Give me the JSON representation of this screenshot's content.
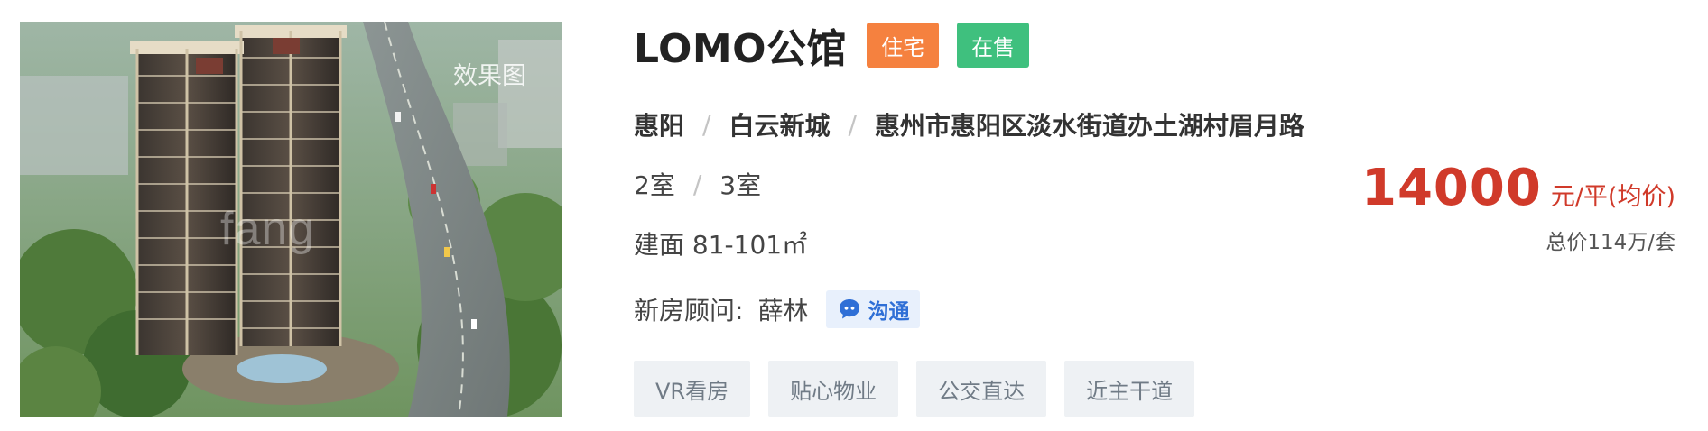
{
  "listing": {
    "image_label": "效果图",
    "watermark": "fang",
    "title": "LOMO公馆",
    "badges": [
      {
        "label": "住宅",
        "color": "#f5813f"
      },
      {
        "label": "在售",
        "color": "#3fc07e"
      }
    ],
    "location": {
      "district": "惠阳",
      "area": "白云新城",
      "address": "惠州市惠阳区淡水街道办土湖村眉月路"
    },
    "rooms": [
      "2室",
      "3室"
    ],
    "area_text": "建面 81-101㎡",
    "consultant": {
      "label": "新房顾问:",
      "name": "薛林",
      "chat_label": "沟通"
    },
    "tags": [
      "VR看房",
      "贴心物业",
      "公交直达",
      "近主干道"
    ],
    "price": {
      "value": "14000",
      "unit": "元/平(均价)",
      "total": "总价114万/套",
      "color": "#d03a2a"
    }
  }
}
